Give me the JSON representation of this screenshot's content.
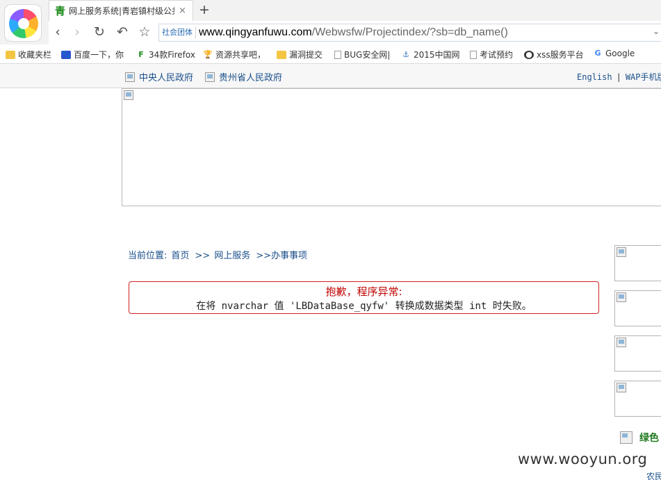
{
  "browser": {
    "tab_favicon": "青",
    "tab_title": "网上服务系统|青岩镇村级公共服",
    "tab_close": "×",
    "new_tab": "+",
    "nav": {
      "back": "‹",
      "forward": "›",
      "reload": "↻",
      "undo": "↶",
      "favorite": "☆"
    },
    "address_badge": "社会团体",
    "url_host": "www.qingyanfuwu.com",
    "url_path": "/Webwsfw/Projectindex/?sb=db_name()",
    "bookmarks": [
      {
        "label": "收藏夹栏",
        "icon": "folder-icon"
      },
      {
        "label": "百度一下，你",
        "icon": "baidu-paw-icon"
      },
      {
        "label": "34款Firefox",
        "icon": "f-letter-icon"
      },
      {
        "label": "资源共享吧，",
        "icon": "trophy-icon"
      },
      {
        "label": "漏洞提交",
        "icon": "folder-icon"
      },
      {
        "label": "BUG安全网|",
        "icon": "page-icon"
      },
      {
        "label": "2015中国网",
        "icon": "anchor-icon"
      },
      {
        "label": "考试预约",
        "icon": "page-icon"
      },
      {
        "label": "xss服务平台",
        "icon": "xss-icon"
      },
      {
        "label": "Google",
        "icon": "google-icon"
      }
    ]
  },
  "page": {
    "top_links": [
      "中央人民政府",
      "贵州省人民政府"
    ],
    "lang_english": "English",
    "lang_wap": "WAP手机版",
    "breadcrumb": {
      "prefix": "当前位置:",
      "home": "首页",
      "sep1": ">>",
      "service": "网上服务",
      "sep2": ">>",
      "current": "办事事项"
    },
    "error": {
      "title": "抱歉，程序异常:",
      "message": "在将 nvarchar 值 'LBDataBase_qyfw' 转换成数据类型 int 时失败。"
    },
    "green_label": "绿色",
    "farm_label": "农民",
    "watermark": "www.wooyun.org"
  },
  "colors": {
    "link": "#1a4f8b",
    "error_border": "#d02020",
    "error_title": "#c00000",
    "green": "#1e7a1e"
  }
}
